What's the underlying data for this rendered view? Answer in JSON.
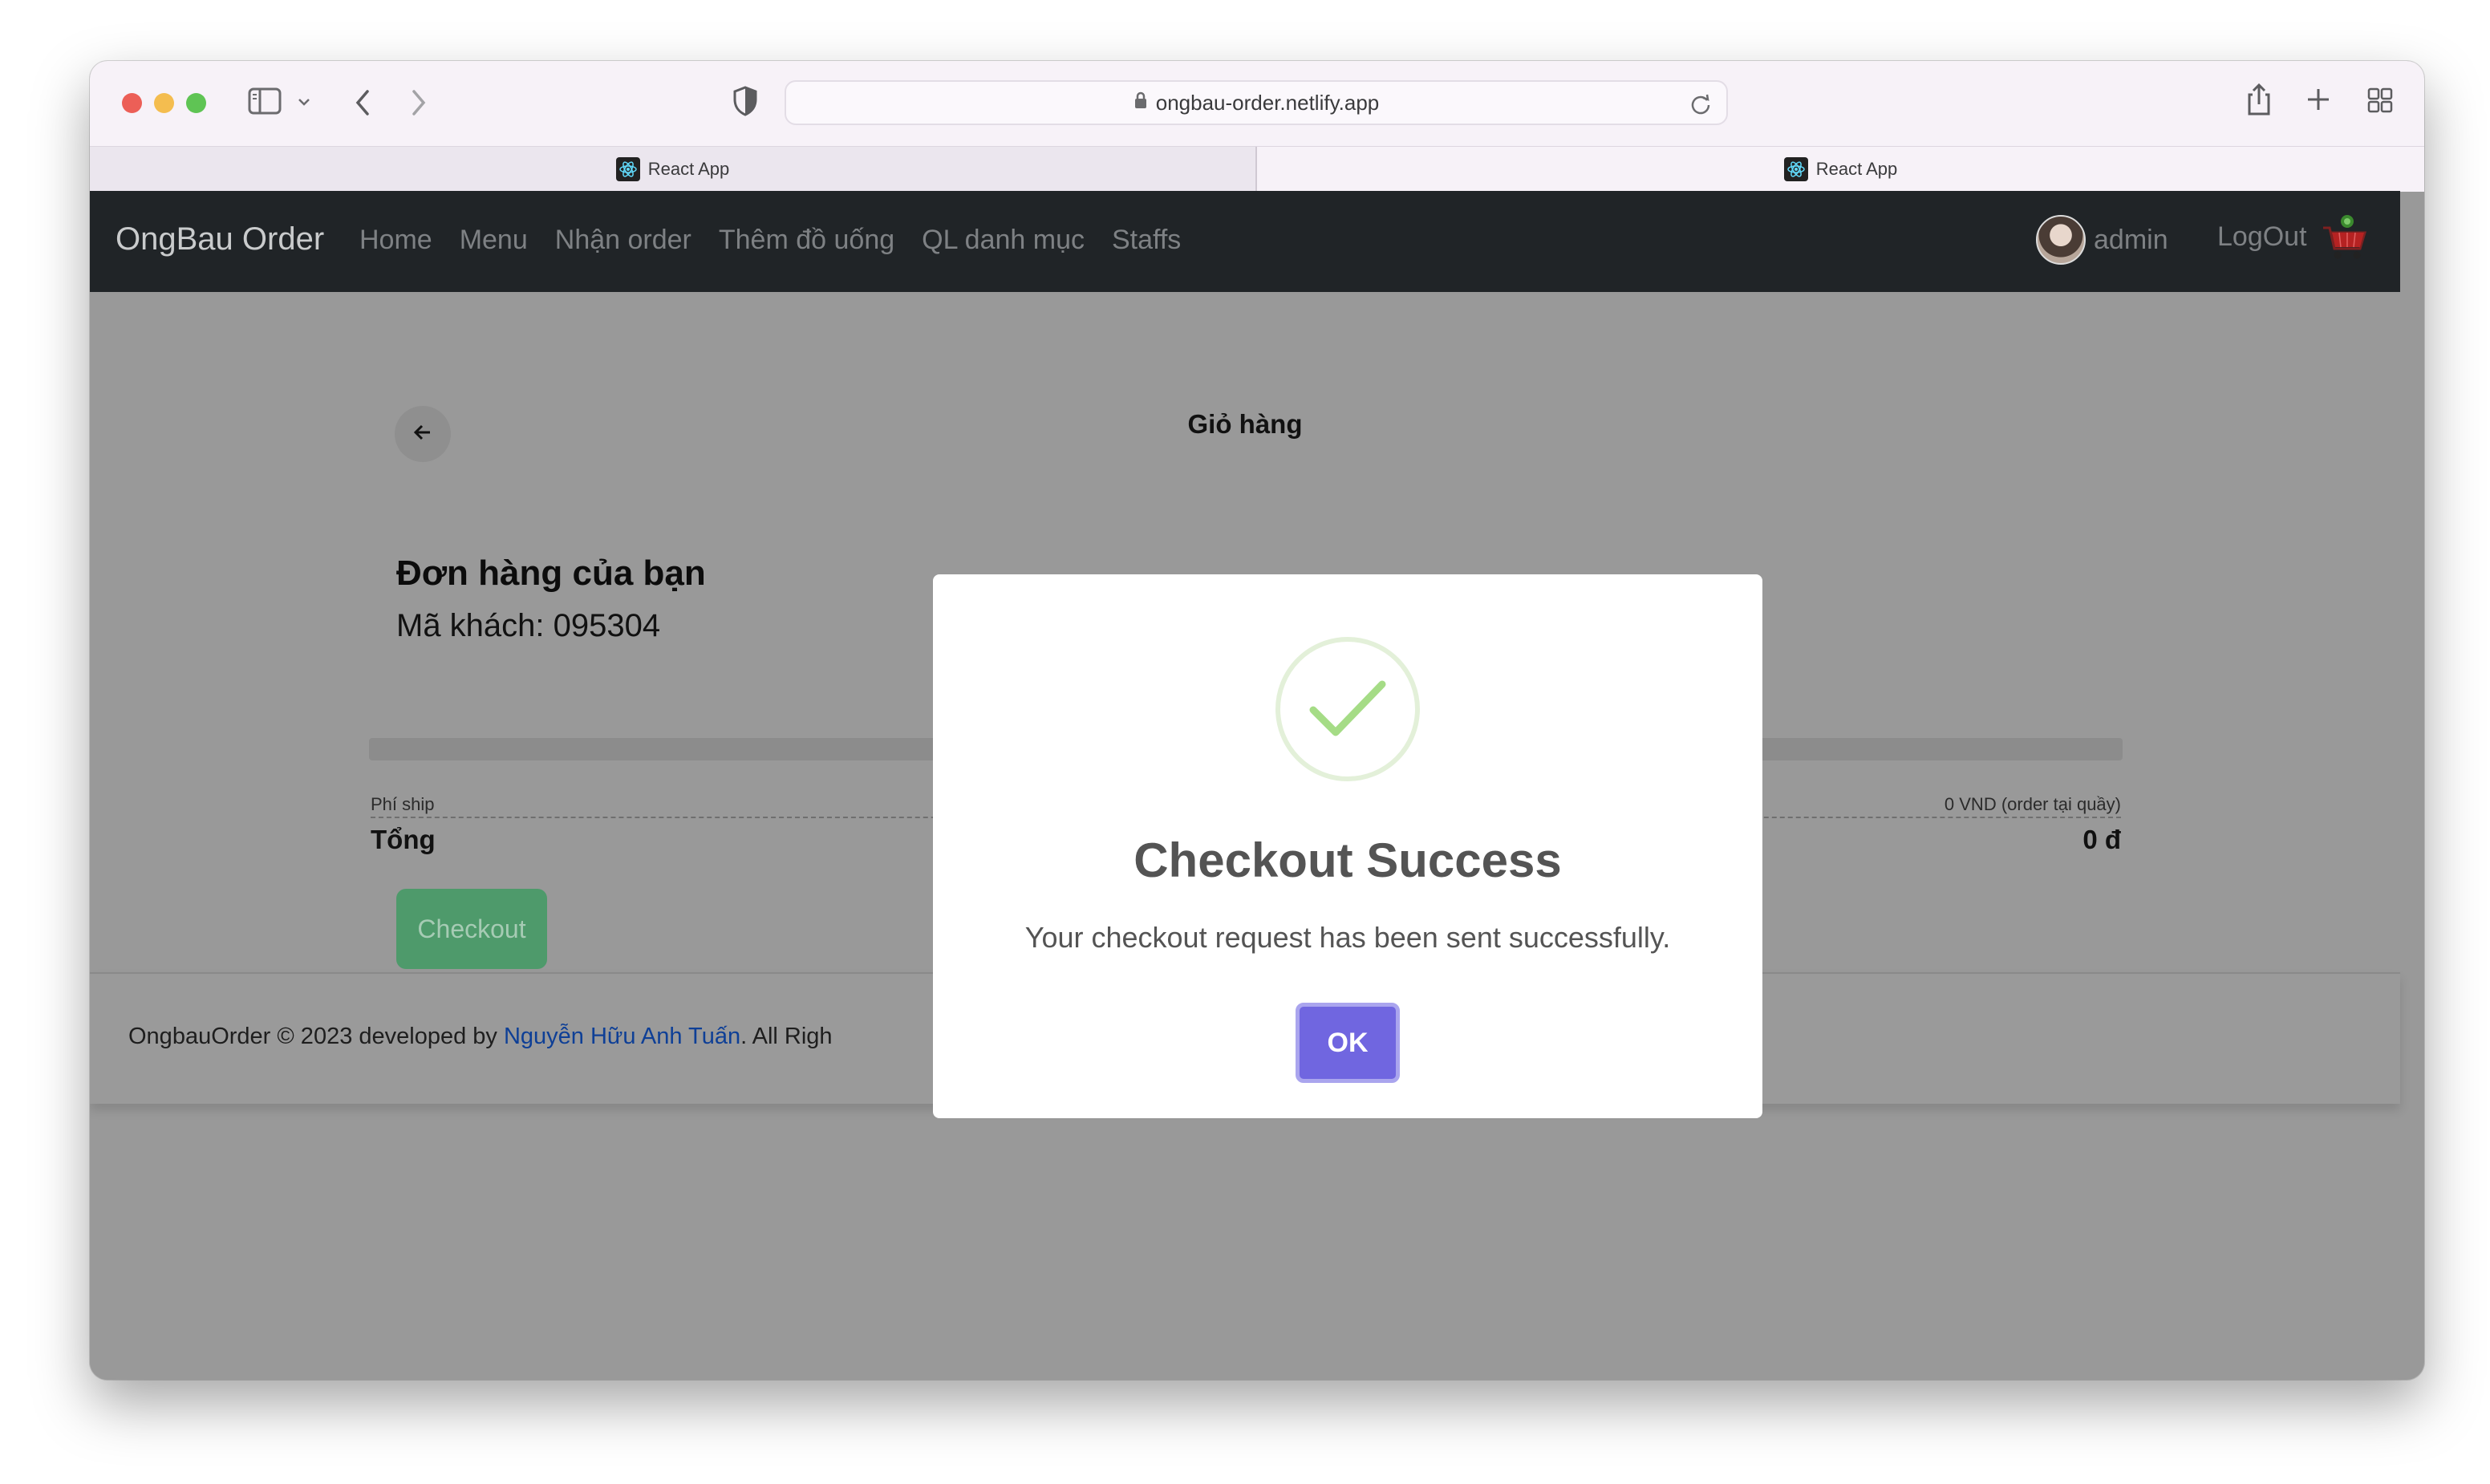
{
  "browser": {
    "url": "ongbau-order.netlify.app",
    "tabs": [
      {
        "label": "React App",
        "active": false
      },
      {
        "label": "React App",
        "active": true
      }
    ]
  },
  "navbar": {
    "brand": "OngBau Order",
    "links": [
      "Home",
      "Menu",
      "Nhận order",
      "Thêm đồ uống",
      "QL danh mục",
      "Staffs"
    ],
    "username": "admin",
    "logout_label": "LogOut"
  },
  "cart": {
    "title": "Giỏ hàng",
    "order_title": "Đơn hàng của bạn",
    "customer_code": "Mã khách: 095304",
    "ship_label": "Phí ship",
    "ship_value": "0 VND (order tại quầy)",
    "total_label": "Tổng",
    "total_value": "0 đ",
    "checkout_label": "Checkout"
  },
  "footer": {
    "prefix": "OngbauOrder © 2023 developed by ",
    "author": "Nguyễn Hữu Anh Tuấn",
    "suffix": ". All Righ"
  },
  "modal": {
    "title": "Checkout Success",
    "message": "Your checkout request has been sent successfully.",
    "ok_label": "OK"
  },
  "colors": {
    "navbar_bg": "#202427",
    "overlay_bg": "#999999",
    "checkout_button": "#4e9a6b",
    "ok_button": "#7066e0",
    "success_check": "#a5dc86",
    "author_link": "#0e3f96"
  }
}
